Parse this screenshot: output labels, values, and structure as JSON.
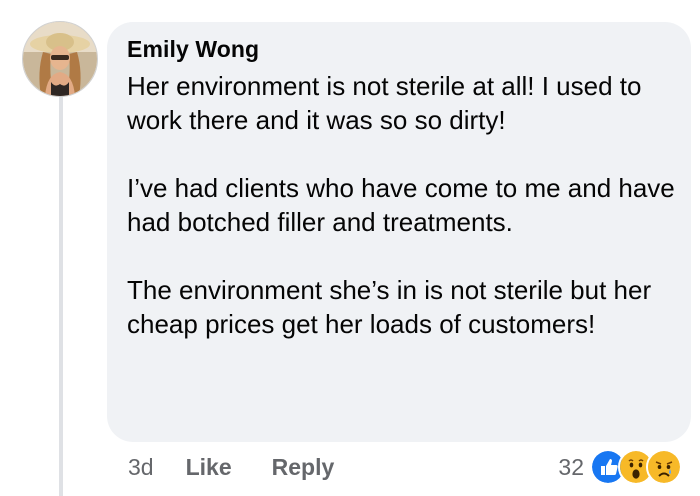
{
  "comment": {
    "author": "Emily Wong",
    "paragraphs": [
      "Her environment is not sterile at all! I used to work there and it was so so dirty!",
      "I’ve had clients who have come to me and have had botched filler and treatments.",
      "The environment she’s in is not sterile but her cheap prices get her loads of customers!"
    ],
    "timestamp": "3d",
    "like_label": "Like",
    "reply_label": "Reply",
    "reaction_count": "32",
    "reactions": [
      "like-icon",
      "wow-icon",
      "sad-icon"
    ]
  },
  "colors": {
    "bubble": "#f0f2f5",
    "text": "#050505",
    "meta": "#65676b",
    "like_blue": "#1877f2",
    "emoji_yellow": "#f7b928"
  }
}
